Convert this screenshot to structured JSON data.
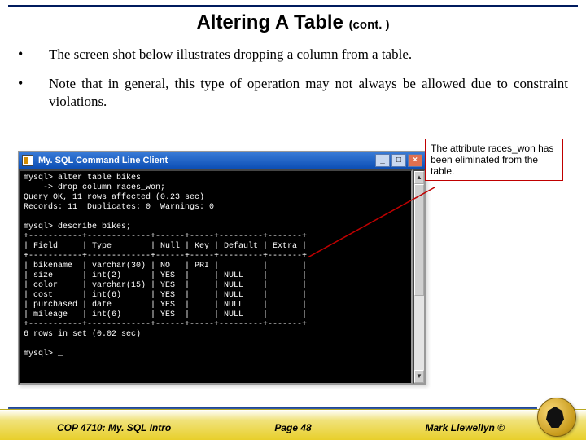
{
  "title_main": "Altering A Table ",
  "title_cont": "(cont. )",
  "bullets": [
    "The screen shot below illustrates dropping a column from a table.",
    "Note that in general, this type of operation may not always be allowed due to constraint violations."
  ],
  "callout_text": "The attribute races_won has been eliminated from the table.",
  "window": {
    "title": "My. SQL Command Line Client",
    "minimize": "_",
    "maximize": "□",
    "close": "×"
  },
  "terminal_lines": "mysql> alter table bikes\n    -> drop column races_won;\nQuery OK, 11 rows affected (0.23 sec)\nRecords: 11  Duplicates: 0  Warnings: 0\n\nmysql> describe bikes;\n+-----------+-------------+------+-----+---------+-------+\n| Field     | Type        | Null | Key | Default | Extra |\n+-----------+-------------+------+-----+---------+-------+\n| bikename  | varchar(30) | NO   | PRI |         |       |\n| size      | int(2)      | YES  |     | NULL    |       |\n| color     | varchar(15) | YES  |     | NULL    |       |\n| cost      | int(6)      | YES  |     | NULL    |       |\n| purchased | date        | YES  |     | NULL    |       |\n| mileage   | int(6)      | YES  |     | NULL    |       |\n+-----------+-------------+------+-----+---------+-------+\n6 rows in set (0.02 sec)\n\nmysql> _",
  "scrollbar": {
    "up": "▲",
    "down": "▼"
  },
  "footer": {
    "left": "COP 4710: My. SQL Intro",
    "center": "Page 48",
    "right": "Mark Llewellyn ©"
  }
}
